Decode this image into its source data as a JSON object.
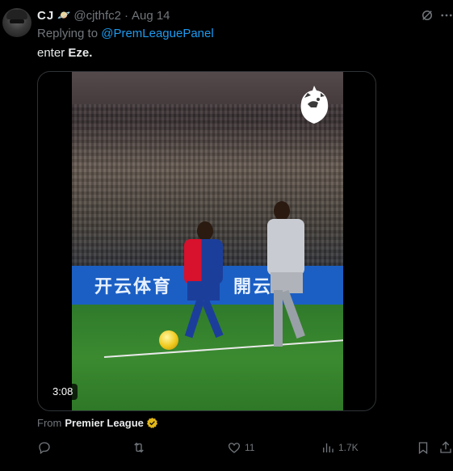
{
  "tweet": {
    "author_name": "CJ",
    "author_emoji": "🪐",
    "handle": "@cjthfc2",
    "separator": "·",
    "date": "Aug 14",
    "reply_prefix": "Replying to",
    "reply_to": "@PremLeaguePanel",
    "text_plain": "enter ",
    "text_bold": "Eze."
  },
  "media": {
    "duration": "3:08",
    "board_left": "开云体育",
    "board_right": "開云"
  },
  "source": {
    "prefix": "From",
    "name": "Premier League"
  },
  "actions": {
    "replies": "",
    "retweets": "",
    "likes": "11",
    "views": "1.7K"
  },
  "colors": {
    "accent": "#1d9bf0",
    "muted": "#71767b",
    "text": "#e7e9ea",
    "verified_gold": "#e2b719"
  },
  "icons": [
    "grok-icon",
    "more-icon",
    "play-timestamp",
    "premier-league-lion-icon",
    "verified-badge-icon",
    "reply-icon",
    "retweet-icon",
    "like-icon",
    "views-icon",
    "bookmark-icon",
    "share-icon"
  ]
}
